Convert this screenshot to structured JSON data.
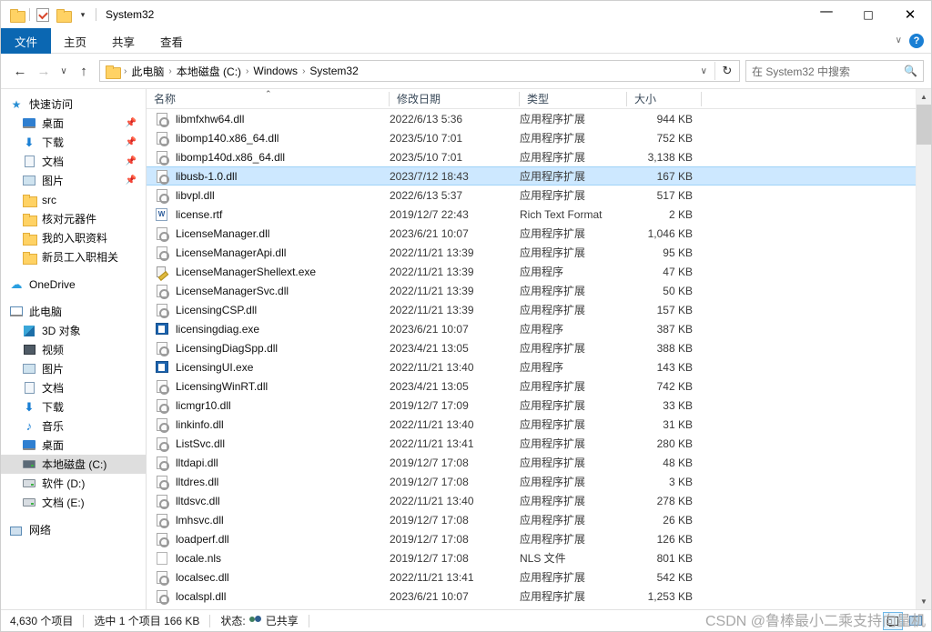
{
  "window": {
    "title": "System32",
    "quick_access": [
      "folder-icon",
      "properties-icon",
      "new-folder-icon",
      "customize-caret"
    ],
    "controls": {
      "minimize": "—",
      "maximize": "☐",
      "close": "✕"
    }
  },
  "ribbon": {
    "tabs": [
      {
        "label": "文件",
        "active": true
      },
      {
        "label": "主页",
        "active": false
      },
      {
        "label": "共享",
        "active": false
      },
      {
        "label": "查看",
        "active": false
      }
    ],
    "collapse_caret": "∨",
    "help_label": "?"
  },
  "address": {
    "back": "←",
    "forward": "→",
    "recent_caret": "∨",
    "up": "↑",
    "breadcrumbs": [
      "此电脑",
      "本地磁盘 (C:)",
      "Windows",
      "System32"
    ],
    "separator": "›",
    "dropdown_caret": "∨",
    "refresh": "↻"
  },
  "search": {
    "placeholder": "在 System32 中搜索",
    "icon": "search-icon"
  },
  "sidebar": {
    "groups": [
      {
        "header": {
          "label": "快速访问",
          "icon": "star-icon"
        },
        "items": [
          {
            "label": "桌面",
            "icon": "desktop-icon",
            "pinned": true
          },
          {
            "label": "下载",
            "icon": "download-icon",
            "pinned": true
          },
          {
            "label": "文档",
            "icon": "documents-icon",
            "pinned": true
          },
          {
            "label": "图片",
            "icon": "pictures-icon",
            "pinned": true
          },
          {
            "label": "src",
            "icon": "folder-icon",
            "pinned": false
          },
          {
            "label": "核对元器件",
            "icon": "folder-icon",
            "pinned": false
          },
          {
            "label": "我的入职资料",
            "icon": "folder-icon",
            "pinned": false
          },
          {
            "label": "新员工入职相关",
            "icon": "folder-icon",
            "pinned": false
          }
        ]
      },
      {
        "header": {
          "label": "OneDrive",
          "icon": "cloud-icon"
        },
        "items": []
      },
      {
        "header": {
          "label": "此电脑",
          "icon": "computer-icon"
        },
        "items": [
          {
            "label": "3D 对象",
            "icon": "3d-objects-icon",
            "pinned": false
          },
          {
            "label": "视频",
            "icon": "videos-icon",
            "pinned": false
          },
          {
            "label": "图片",
            "icon": "pictures-icon",
            "pinned": false
          },
          {
            "label": "文档",
            "icon": "documents-icon",
            "pinned": false
          },
          {
            "label": "下载",
            "icon": "download-icon",
            "pinned": false
          },
          {
            "label": "音乐",
            "icon": "music-icon",
            "pinned": false
          },
          {
            "label": "桌面",
            "icon": "desktop-icon",
            "pinned": false
          },
          {
            "label": "本地磁盘 (C:)",
            "icon": "system-drive-icon",
            "pinned": false,
            "selected": true
          },
          {
            "label": "软件 (D:)",
            "icon": "drive-icon",
            "pinned": false
          },
          {
            "label": "文档 (E:)",
            "icon": "drive-icon",
            "pinned": false
          }
        ]
      },
      {
        "header": {
          "label": "网络",
          "icon": "network-icon"
        },
        "items": []
      }
    ]
  },
  "filelist": {
    "columns": [
      "名称",
      "修改日期",
      "类型",
      "大小"
    ],
    "sort_indicator": "⌃",
    "rows": [
      {
        "name": "libmfxhw64.dll",
        "date": "2022/6/13 5:36",
        "type": "应用程序扩展",
        "size": "944 KB",
        "icon": "dll-icon"
      },
      {
        "name": "libomp140.x86_64.dll",
        "date": "2023/5/10 7:01",
        "type": "应用程序扩展",
        "size": "752 KB",
        "icon": "dll-icon"
      },
      {
        "name": "libomp140d.x86_64.dll",
        "date": "2023/5/10 7:01",
        "type": "应用程序扩展",
        "size": "3,138 KB",
        "icon": "dll-icon"
      },
      {
        "name": "libusb-1.0.dll",
        "date": "2023/7/12 18:43",
        "type": "应用程序扩展",
        "size": "167 KB",
        "icon": "dll-icon",
        "selected": true
      },
      {
        "name": "libvpl.dll",
        "date": "2022/6/13 5:37",
        "type": "应用程序扩展",
        "size": "517 KB",
        "icon": "dll-icon"
      },
      {
        "name": "license.rtf",
        "date": "2019/12/7 22:43",
        "type": "Rich Text Format",
        "size": "2 KB",
        "icon": "rtf-icon"
      },
      {
        "name": "LicenseManager.dll",
        "date": "2023/6/21 10:07",
        "type": "应用程序扩展",
        "size": "1,046 KB",
        "icon": "dll-icon"
      },
      {
        "name": "LicenseManagerApi.dll",
        "date": "2022/11/21 13:39",
        "type": "应用程序扩展",
        "size": "95 KB",
        "icon": "dll-icon"
      },
      {
        "name": "LicenseManagerShellext.exe",
        "date": "2022/11/21 13:39",
        "type": "应用程序",
        "size": "47 KB",
        "icon": "shellext-icon"
      },
      {
        "name": "LicenseManagerSvc.dll",
        "date": "2022/11/21 13:39",
        "type": "应用程序扩展",
        "size": "50 KB",
        "icon": "dll-icon"
      },
      {
        "name": "LicensingCSP.dll",
        "date": "2022/11/21 13:39",
        "type": "应用程序扩展",
        "size": "157 KB",
        "icon": "dll-icon"
      },
      {
        "name": "licensingdiag.exe",
        "date": "2023/6/21 10:07",
        "type": "应用程序",
        "size": "387 KB",
        "icon": "exe-icon"
      },
      {
        "name": "LicensingDiagSpp.dll",
        "date": "2023/4/21 13:05",
        "type": "应用程序扩展",
        "size": "388 KB",
        "icon": "dll-icon"
      },
      {
        "name": "LicensingUI.exe",
        "date": "2022/11/21 13:40",
        "type": "应用程序",
        "size": "143 KB",
        "icon": "exe-icon"
      },
      {
        "name": "LicensingWinRT.dll",
        "date": "2023/4/21 13:05",
        "type": "应用程序扩展",
        "size": "742 KB",
        "icon": "dll-icon"
      },
      {
        "name": "licmgr10.dll",
        "date": "2019/12/7 17:09",
        "type": "应用程序扩展",
        "size": "33 KB",
        "icon": "dll-icon"
      },
      {
        "name": "linkinfo.dll",
        "date": "2022/11/21 13:40",
        "type": "应用程序扩展",
        "size": "31 KB",
        "icon": "dll-icon"
      },
      {
        "name": "ListSvc.dll",
        "date": "2022/11/21 13:41",
        "type": "应用程序扩展",
        "size": "280 KB",
        "icon": "dll-icon"
      },
      {
        "name": "lltdapi.dll",
        "date": "2019/12/7 17:08",
        "type": "应用程序扩展",
        "size": "48 KB",
        "icon": "dll-icon"
      },
      {
        "name": "lltdres.dll",
        "date": "2019/12/7 17:08",
        "type": "应用程序扩展",
        "size": "3 KB",
        "icon": "dll-icon"
      },
      {
        "name": "lltdsvc.dll",
        "date": "2022/11/21 13:40",
        "type": "应用程序扩展",
        "size": "278 KB",
        "icon": "dll-icon"
      },
      {
        "name": "lmhsvc.dll",
        "date": "2019/12/7 17:08",
        "type": "应用程序扩展",
        "size": "26 KB",
        "icon": "dll-icon"
      },
      {
        "name": "loadperf.dll",
        "date": "2019/12/7 17:08",
        "type": "应用程序扩展",
        "size": "126 KB",
        "icon": "dll-icon"
      },
      {
        "name": "locale.nls",
        "date": "2019/12/7 17:08",
        "type": "NLS 文件",
        "size": "801 KB",
        "icon": "nls-icon"
      },
      {
        "name": "localsec.dll",
        "date": "2022/11/21 13:41",
        "type": "应用程序扩展",
        "size": "542 KB",
        "icon": "dll-icon"
      },
      {
        "name": "localspl.dll",
        "date": "2023/6/21 10:07",
        "type": "应用程序扩展",
        "size": "1,253 KB",
        "icon": "dll-icon"
      }
    ]
  },
  "status": {
    "item_count": "4,630 个项目",
    "selection": "选中 1 个项目  166 KB",
    "state_label": "状态:",
    "state_value": "已共享",
    "view_details": "details-view",
    "view_large": "large-icons-view"
  },
  "watermark": "CSDN @鲁棒最小二乘支持向量机",
  "colors": {
    "accent": "#0b67b2",
    "selection": "#cde8ff",
    "selection_border": "#9fd2f7",
    "sidebar_selected": "#dedede",
    "folder_yellow": "#ffd264"
  }
}
